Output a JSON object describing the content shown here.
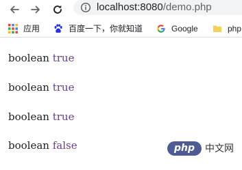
{
  "browser": {
    "icons": {
      "back": "arrow-back-icon",
      "forward": "arrow-forward-icon",
      "reload": "reload-icon",
      "site_info": "info-icon"
    },
    "address": {
      "host": "localhost:8080",
      "path": "/demo.php"
    },
    "bookmarks": [
      {
        "label": "应用",
        "icon": "apps-grid-icon"
      },
      {
        "label": "百度一下，你就知道",
        "icon": "baidu-paw-icon"
      },
      {
        "label": "Google",
        "icon": "google-g-icon"
      },
      {
        "label": "php",
        "icon": "folder-icon"
      }
    ]
  },
  "page": {
    "lines": [
      {
        "type": "boolean",
        "value": "true"
      },
      {
        "type": "boolean",
        "value": "true"
      },
      {
        "type": "boolean",
        "value": "true"
      },
      {
        "type": "boolean",
        "value": "false"
      }
    ]
  },
  "watermark": {
    "logo_text": "php",
    "site_text": "中文网"
  },
  "colors": {
    "text": "#212121",
    "value": "#6a3d8a",
    "toolbar_icon": "#5f6368",
    "omnibox_bg": "#f1f3f4",
    "php_logo": "#4f5b93"
  }
}
